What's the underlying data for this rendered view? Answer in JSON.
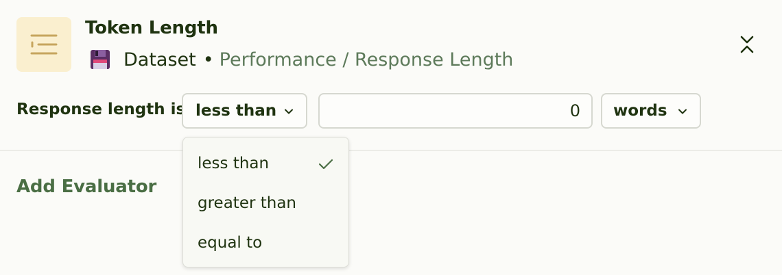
{
  "header": {
    "title": "Token Length",
    "source": "Dataset",
    "separator": "•",
    "path": "Performance / Response Length",
    "icon": "list-icon",
    "source_icon": "save-disk-icon",
    "collapse_icon": "collapse-chevrons-icon"
  },
  "condition": {
    "label": "Response length is",
    "operator": "less than",
    "value": "0",
    "unit": "words"
  },
  "dropdown": {
    "options": [
      {
        "label": "less than",
        "selected": true
      },
      {
        "label": "greater than",
        "selected": false
      },
      {
        "label": "equal to",
        "selected": false
      }
    ]
  },
  "actions": {
    "add_evaluator": "Add Evaluator"
  },
  "colors": {
    "text_primary": "#1f3310",
    "text_muted": "#5d7a5a",
    "accent_green": "#4a6e44",
    "icon_tile_bg": "#faefcf",
    "icon_gold": "#c6a55e",
    "border": "#d6d8d0"
  }
}
